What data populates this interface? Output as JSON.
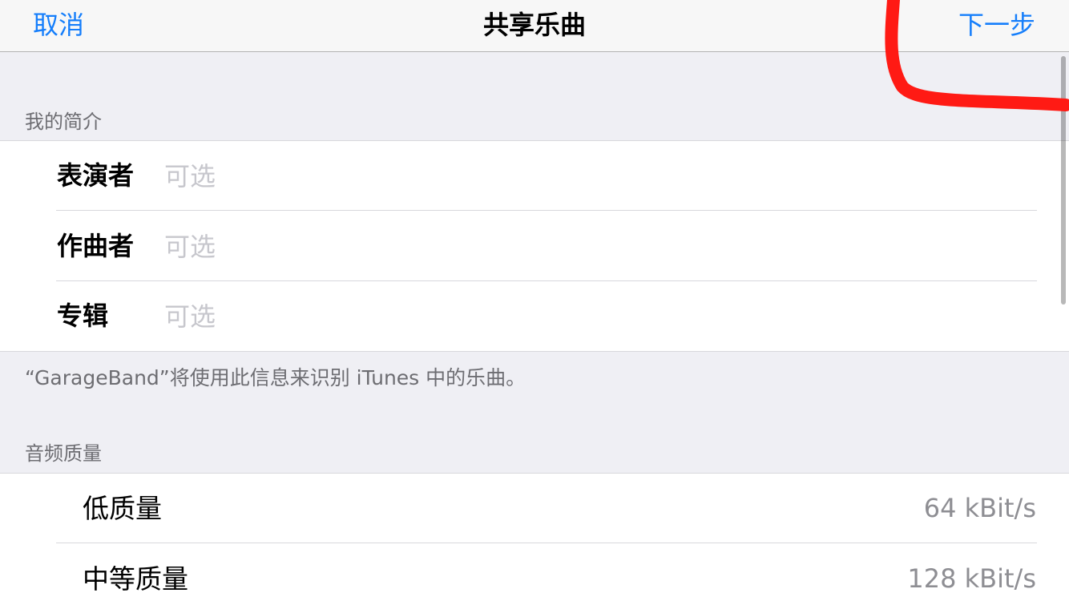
{
  "navbar": {
    "cancel": "取消",
    "title": "共享乐曲",
    "next": "下一步"
  },
  "profile": {
    "header": "我的简介",
    "fields": [
      {
        "label": "表演者",
        "placeholder": "可选",
        "value": ""
      },
      {
        "label": "作曲者",
        "placeholder": "可选",
        "value": ""
      },
      {
        "label": "专辑",
        "placeholder": "可选",
        "value": ""
      }
    ],
    "footer": "“GarageBand”将使用此信息来识别 iTunes 中的乐曲。"
  },
  "audio_quality": {
    "header": "音频质量",
    "options": [
      {
        "label": "低质量",
        "bitrate": "64 kBit/s"
      },
      {
        "label": "中等质量",
        "bitrate": "128 kBit/s"
      }
    ]
  },
  "colors": {
    "accent": "#157efb",
    "background": "#efeff4",
    "annotation_marker": "#ff1a14"
  }
}
